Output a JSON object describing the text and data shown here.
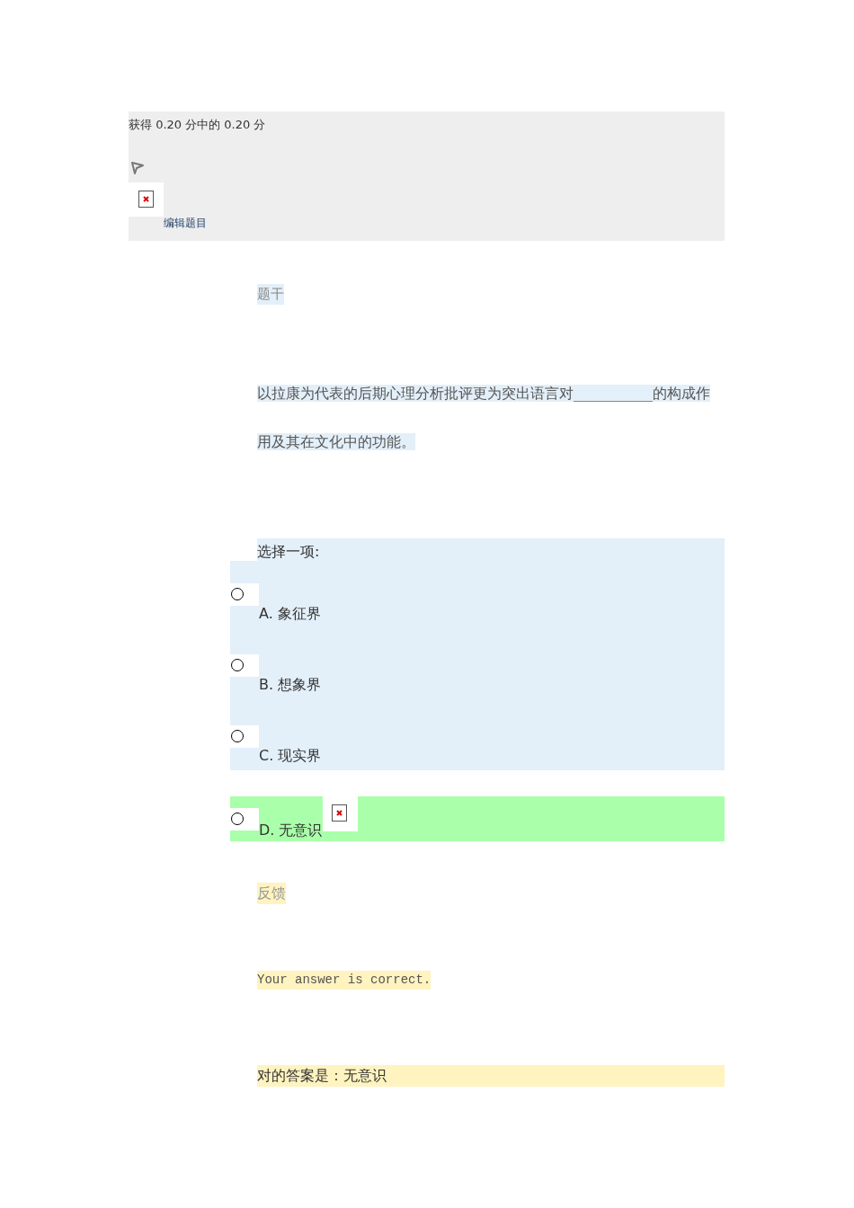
{
  "header": {
    "grade": "获得 0.20 分中的 0.20 分",
    "edit_link": "编辑题目"
  },
  "stem": {
    "label": "题干",
    "text": "以拉康为代表的后期心理分析批评更为突出语言对___________的构成作用及其在文化中的功能。"
  },
  "answer": {
    "prompt": "选择一项:",
    "options": [
      {
        "label": "A. 象征界",
        "selected": false,
        "correct": false
      },
      {
        "label": "B. 想象界",
        "selected": false,
        "correct": false
      },
      {
        "label": "C. 现实界",
        "selected": false,
        "correct": false
      },
      {
        "label": "D. 无意识",
        "selected": false,
        "correct": true
      }
    ]
  },
  "feedback": {
    "label": "反馈",
    "message": "Your answer is correct.",
    "right_answer": "对的答案是：无意识"
  }
}
